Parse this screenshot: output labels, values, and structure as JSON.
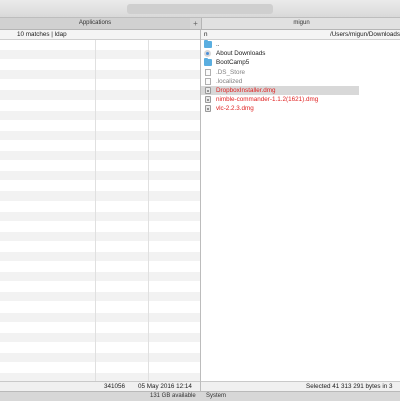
{
  "tabs": {
    "left": "Applications",
    "add": "+",
    "right": "migun"
  },
  "left_pane": {
    "header": "10 matches | ldap",
    "status_size": "341056",
    "status_date": "05 May 2016 12:14",
    "available": "131 GB available"
  },
  "right_pane": {
    "column": "n",
    "path": "/Users/migun/Downloads",
    "status": "Selected 41 313 291 bytes in 3",
    "volume": "System",
    "files": [
      {
        "name": "..",
        "icon": "folder-icon",
        "style": "normal"
      },
      {
        "name": "About Downloads",
        "icon": "alias-icon",
        "style": "normal"
      },
      {
        "name": "BootCamp5",
        "icon": "folder-icon",
        "style": "normal"
      },
      {
        "name": ".DS_Store",
        "icon": "document-icon",
        "style": "grey"
      },
      {
        "name": ".localized",
        "icon": "document-icon",
        "style": "grey"
      },
      {
        "name": "DropboxInstaller.dmg",
        "icon": "disk-image-icon",
        "style": "red-selected"
      },
      {
        "name": "nimble-commander-1.1.2(1621).dmg",
        "icon": "disk-image-icon",
        "style": "red"
      },
      {
        "name": "vlc-2.2.3.dmg",
        "icon": "disk-image-icon",
        "style": "red"
      }
    ]
  },
  "colors": {
    "highlight_text": "#e02020",
    "selection": "#d8d8d8",
    "folder": "#5aaee0"
  }
}
